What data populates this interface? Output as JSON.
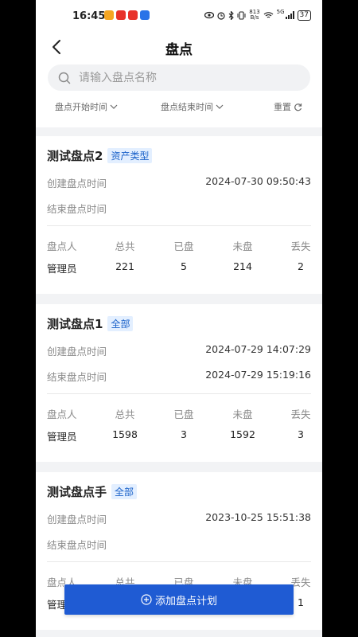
{
  "status": {
    "time": "16:45",
    "speed_value": "813",
    "speed_unit": "B/s",
    "signal_label": "5G",
    "battery": "37"
  },
  "header": {
    "title": "盘点",
    "search_placeholder": "请输入盘点名称"
  },
  "filters": {
    "start_time": "盘点开始时间",
    "end_time": "盘点结束时间",
    "reset": "重置"
  },
  "labels": {
    "create_time": "创建盘点时间",
    "end_time": "结束盘点时间",
    "stat_headers": [
      "盘点人",
      "总共",
      "已盘",
      "未盘",
      "丢失"
    ]
  },
  "cards": [
    {
      "name": "测试盘点2",
      "tag": "资产类型",
      "create_time": "2024-07-30 09:50:43",
      "end_time": "",
      "stats": [
        "管理员",
        "221",
        "5",
        "214",
        "2"
      ]
    },
    {
      "name": "测试盘点1",
      "tag": "全部",
      "create_time": "2024-07-29 14:07:29",
      "end_time": "2024-07-29 15:19:16",
      "stats": [
        "管理员",
        "1598",
        "3",
        "1592",
        "3"
      ]
    },
    {
      "name": "测试盘点手",
      "tag": "全部",
      "create_time": "2023-10-25 15:51:38",
      "end_time": "",
      "stats": [
        "管理员",
        "",
        "",
        "",
        "1"
      ]
    }
  ],
  "add_button": "添加盘点计划",
  "colors": {
    "accent": "#1f5bd3",
    "tag_text": "#1b62c9",
    "tag_bg": "#e3efff",
    "page_bg": "#f2f3f5"
  }
}
